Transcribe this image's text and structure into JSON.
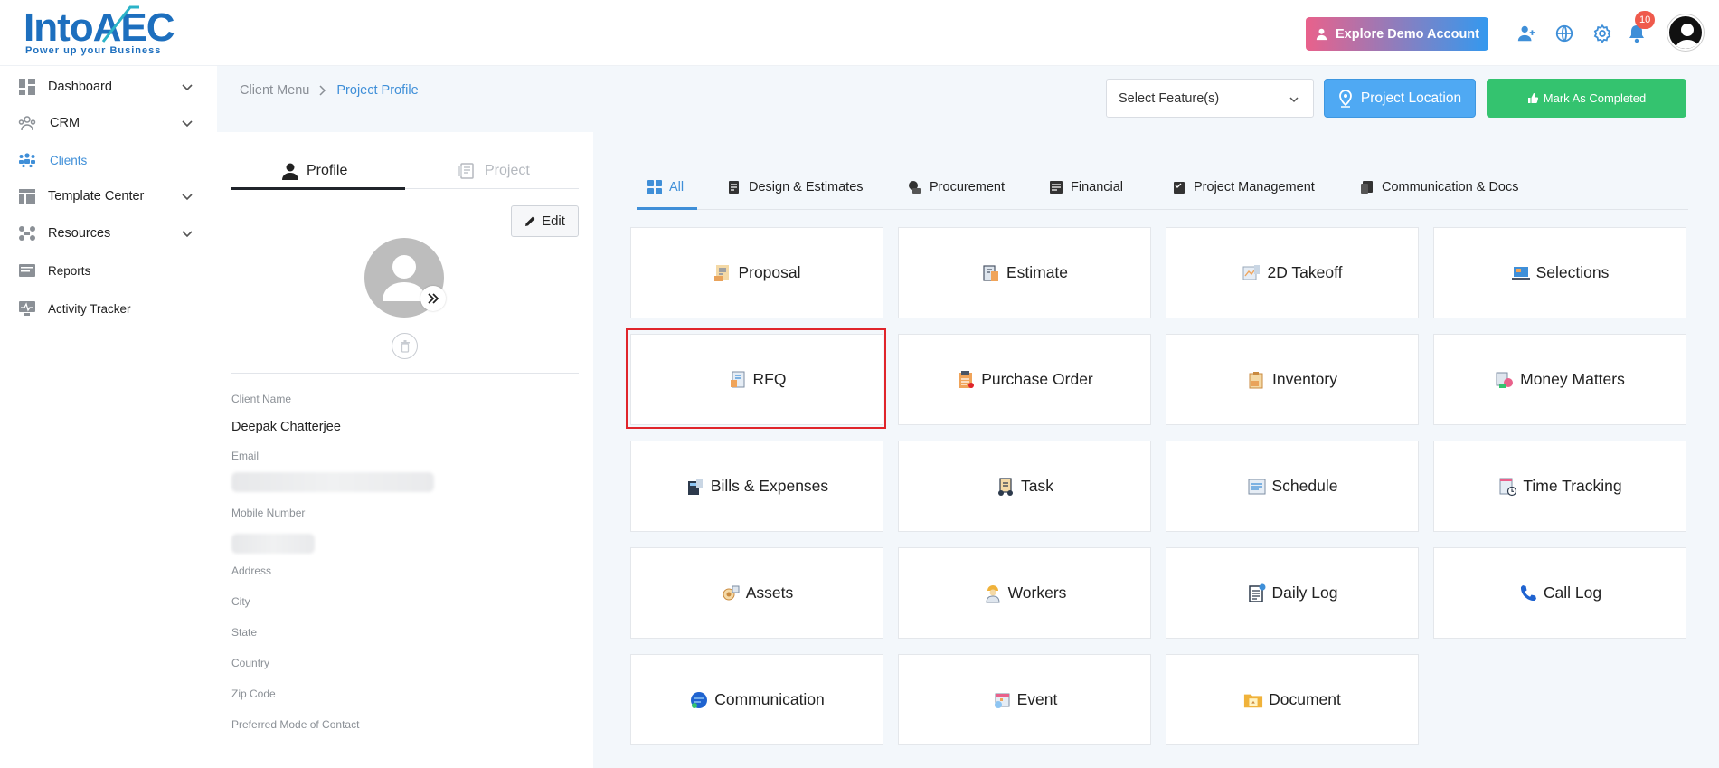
{
  "header": {
    "logo_text_a": "Into",
    "logo_text_b": "AEC",
    "logo_tagline": "Power up your Business",
    "demo_button": "Explore Demo Account",
    "notification_count": "10"
  },
  "sidebar": {
    "items": [
      {
        "label": "Dashboard"
      },
      {
        "label": "CRM"
      },
      {
        "label": "Clients"
      },
      {
        "label": "Template Center"
      },
      {
        "label": "Resources"
      },
      {
        "label": "Reports"
      },
      {
        "label": "Activity Tracker"
      }
    ]
  },
  "breadcrumb": {
    "parent": "Client Menu",
    "current": "Project Profile"
  },
  "toolbar": {
    "select_placeholder": "Select Feature(s)",
    "location_button": "Project Location",
    "complete_button": "Mark As Completed"
  },
  "profile": {
    "tab_profile": "Profile",
    "tab_project": "Project",
    "edit_button": "Edit",
    "fields": {
      "client_name_label": "Client Name",
      "client_name_value": "Deepak Chatterjee",
      "email_label": "Email",
      "mobile_label": "Mobile Number",
      "address_label": "Address",
      "city_label": "City",
      "state_label": "State",
      "country_label": "Country",
      "zip_label": "Zip Code",
      "contact_label": "Preferred Mode of Contact"
    }
  },
  "tabs": [
    {
      "label": "All"
    },
    {
      "label": "Design & Estimates"
    },
    {
      "label": "Procurement"
    },
    {
      "label": "Financial"
    },
    {
      "label": "Project Management"
    },
    {
      "label": "Communication & Docs"
    }
  ],
  "cards": [
    {
      "label": "Proposal"
    },
    {
      "label": "Estimate"
    },
    {
      "label": "2D Takeoff"
    },
    {
      "label": "Selections"
    },
    {
      "label": "RFQ"
    },
    {
      "label": "Purchase Order"
    },
    {
      "label": "Inventory"
    },
    {
      "label": "Money Matters"
    },
    {
      "label": "Bills & Expenses"
    },
    {
      "label": "Task"
    },
    {
      "label": "Schedule"
    },
    {
      "label": "Time Tracking"
    },
    {
      "label": "Assets"
    },
    {
      "label": "Workers"
    },
    {
      "label": "Daily Log"
    },
    {
      "label": "Call Log"
    },
    {
      "label": "Communication"
    },
    {
      "label": "Event"
    },
    {
      "label": "Document"
    }
  ],
  "colors": {
    "accent": "#3f8fd8",
    "success": "#34c36f",
    "highlight": "#e0252b"
  }
}
